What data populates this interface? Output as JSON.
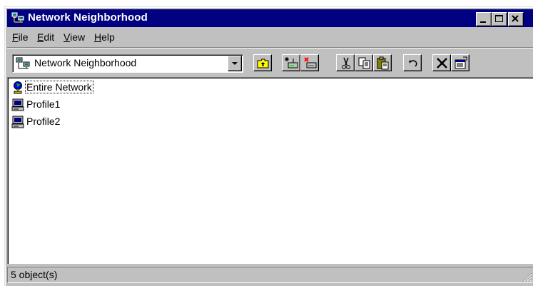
{
  "window": {
    "title": "Network Neighborhood",
    "title_icon": "network-neighborhood-icon",
    "controls": [
      "minimize",
      "maximize",
      "close"
    ]
  },
  "menu": {
    "items": [
      {
        "label": "File",
        "accel": "F",
        "rest": "ile"
      },
      {
        "label": "Edit",
        "accel": "E",
        "rest": "dit"
      },
      {
        "label": "View",
        "accel": "V",
        "rest": "iew"
      },
      {
        "label": "Help",
        "accel": "H",
        "rest": "elp"
      }
    ]
  },
  "toolbar": {
    "address": "Network Neighborhood",
    "buttons": [
      "up-one-level",
      "map-network-drive",
      "disconnect-network-drive",
      "cut",
      "copy",
      "paste",
      "undo",
      "delete",
      "properties"
    ]
  },
  "content": {
    "items": [
      {
        "label": "Entire Network",
        "icon": "globe-network-icon"
      },
      {
        "label": "Profile1",
        "icon": "computer-icon"
      },
      {
        "label": "Profile2",
        "icon": "computer-icon"
      }
    ]
  },
  "status": {
    "text": "5 object(s)"
  },
  "colors": {
    "titlebar": "#000080",
    "face": "#c0c0c0"
  }
}
